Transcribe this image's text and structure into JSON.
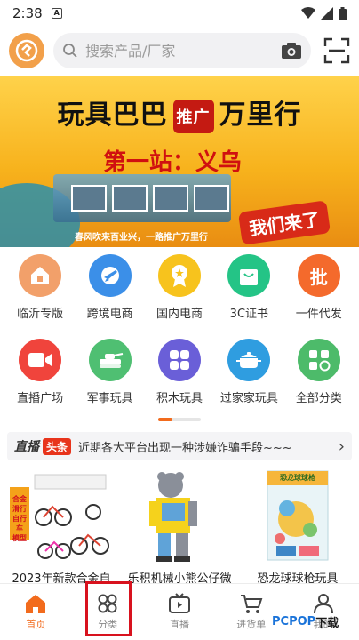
{
  "status_bar": {
    "time": "2:38",
    "notif": "A"
  },
  "header": {
    "search_placeholder": "搜索产品/厂家"
  },
  "banner": {
    "title_left": "玩具巴巴",
    "title_badge": "推广",
    "title_right": "万里行",
    "subtitle": "第一站：义乌",
    "slogan": "春风吹来百业兴，一路推广万里行",
    "callout": "我们来了"
  },
  "categories": [
    {
      "label": "临沂专版",
      "color": "#f2a06a",
      "icon": "house-icon"
    },
    {
      "label": "跨境电商",
      "color": "#3b8fe8",
      "icon": "plane-icon"
    },
    {
      "label": "国内电商",
      "color": "#f7c31d",
      "icon": "badge-icon"
    },
    {
      "label": "3C证书",
      "color": "#24c486",
      "icon": "bag-icon"
    },
    {
      "label": "一件代发",
      "color": "#f46a2c",
      "icon": "wholesale-icon",
      "glyph": "批"
    },
    {
      "label": "直播广场",
      "color": "#f0443c",
      "icon": "video-icon"
    },
    {
      "label": "军事玩具",
      "color": "#4fbf72",
      "icon": "tank-icon"
    },
    {
      "label": "积木玩具",
      "color": "#6a5fd8",
      "icon": "blocks-icon"
    },
    {
      "label": "过家家玩具",
      "color": "#2f9de0",
      "icon": "pot-icon"
    },
    {
      "label": "全部分类",
      "color": "#4dbb6a",
      "icon": "grid-icon"
    }
  ],
  "ticker": {
    "logo": "直播",
    "tag": "头条",
    "text": "近期各大平台出现一种涉嫌诈骗手段~~~"
  },
  "products": [
    {
      "title": "2023年新款合金自",
      "badge_lines": [
        "合金",
        "滑行",
        "自行车",
        "模型"
      ]
    },
    {
      "title": "乐积机械小熊公仔微"
    },
    {
      "title": "恐龙球球枪玩具",
      "box_label": "恐龙球球枪"
    }
  ],
  "bottom_nav": [
    {
      "label": "首页",
      "icon": "home-icon",
      "active": true
    },
    {
      "label": "分类",
      "icon": "category-icon",
      "active": false
    },
    {
      "label": "直播",
      "icon": "tv-icon",
      "active": false
    },
    {
      "label": "进货单",
      "icon": "cart-icon",
      "active": false
    },
    {
      "label": "我的",
      "icon": "user-icon",
      "active": false
    }
  ],
  "watermark": {
    "brand": "PCPOP",
    "suffix": "下载"
  },
  "colors": {
    "accent": "#f26b1d",
    "highlight": "#d8121e"
  }
}
